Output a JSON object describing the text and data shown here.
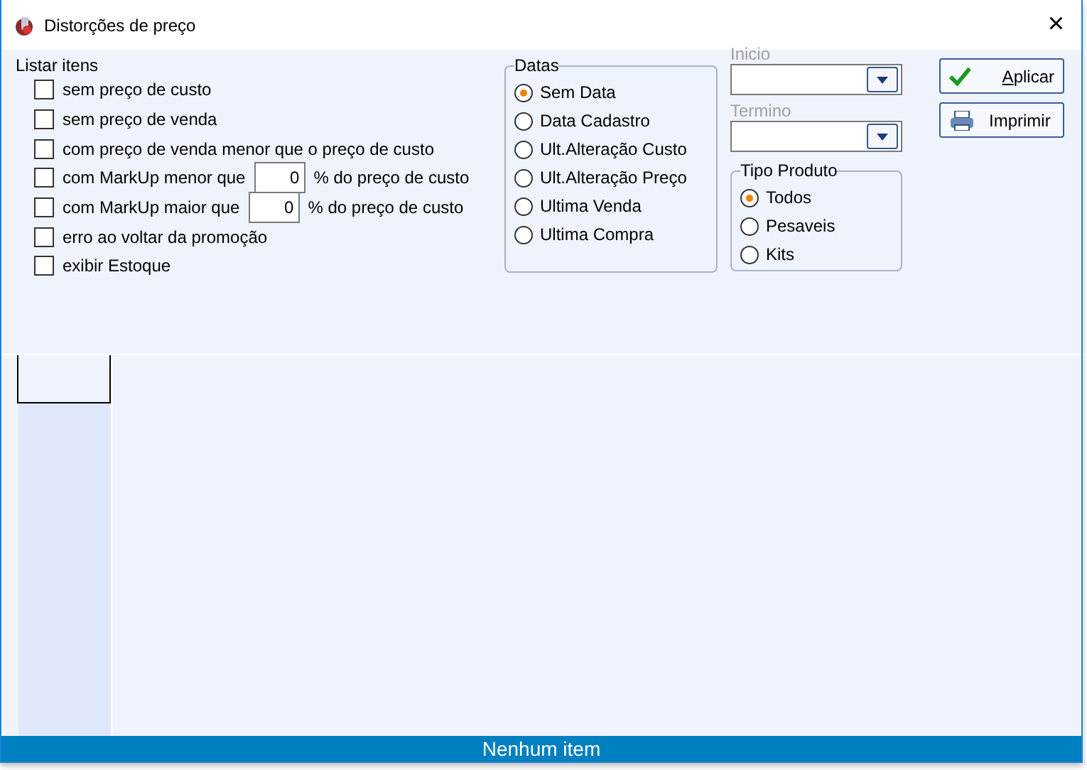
{
  "window": {
    "title": "Distorções de preço",
    "close": "×"
  },
  "listar": {
    "title": "Listar itens",
    "options": [
      {
        "kind": "check",
        "label": "sem preço de custo",
        "checked": false
      },
      {
        "kind": "check",
        "label": "sem preço de venda",
        "checked": false
      },
      {
        "kind": "check",
        "label": "com preço de venda menor que o preço de custo",
        "checked": false
      },
      {
        "kind": "markup",
        "label": "com MarkUp menor que",
        "value": "0",
        "suffix": "% do preço de custo",
        "checked": false
      },
      {
        "kind": "markup",
        "label": "com MarkUp maior que",
        "value": "0",
        "suffix": "% do preço de custo",
        "checked": false
      },
      {
        "kind": "check",
        "label": "erro ao voltar da promoção",
        "checked": false
      },
      {
        "kind": "check",
        "label": "exibir Estoque",
        "checked": false
      }
    ]
  },
  "datas": {
    "title": "Datas",
    "options": [
      {
        "label": "Sem Data",
        "selected": true
      },
      {
        "label": "Data Cadastro",
        "selected": false
      },
      {
        "label": "Ult.Alteração Custo",
        "selected": false
      },
      {
        "label": "Ult.Alteração Preço",
        "selected": false
      },
      {
        "label": "Ultima Venda",
        "selected": false
      },
      {
        "label": "Ultima Compra",
        "selected": false
      }
    ]
  },
  "date_fields": [
    {
      "label": "Inicio",
      "disabled": true
    },
    {
      "label": "Termino",
      "disabled": true
    }
  ],
  "tipo_produto": {
    "title": "Tipo Produto",
    "options": [
      {
        "label": "Todos",
        "selected": true
      },
      {
        "label": "Pesaveis",
        "selected": false
      },
      {
        "label": "Kits",
        "selected": false
      }
    ]
  },
  "buttons": [
    {
      "kind": "apply",
      "label": "Aplicar",
      "underline_first": true
    },
    {
      "kind": "print",
      "label": "Imprimir"
    }
  ],
  "status_bar": "Nenhum item"
}
